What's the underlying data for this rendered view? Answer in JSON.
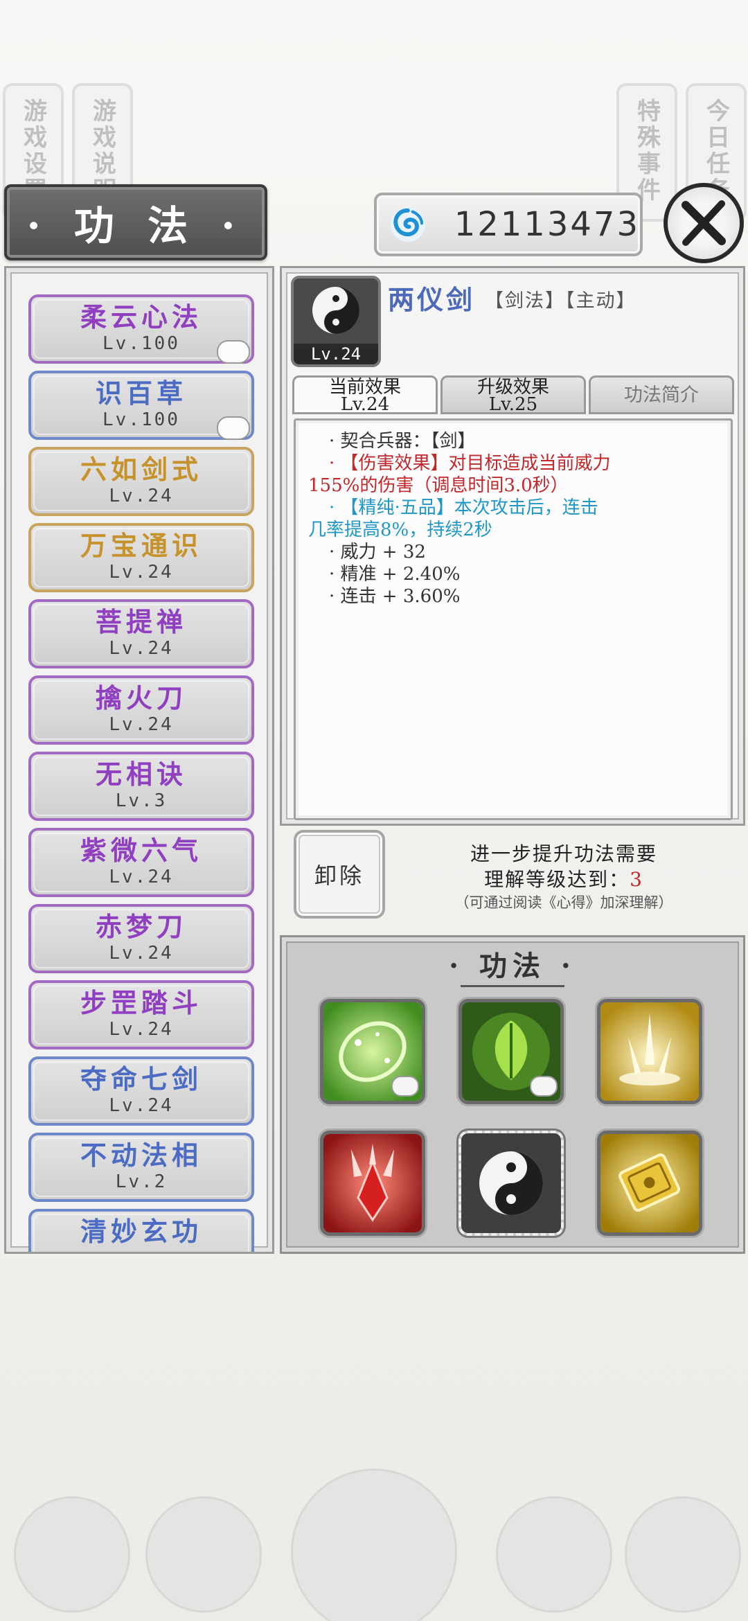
{
  "background_tabs": [
    {
      "label": "游戏设置"
    },
    {
      "label": "游戏说明"
    },
    {
      "label": "特殊事件"
    },
    {
      "label": "今日任务"
    }
  ],
  "header": {
    "title": "· 功 法 ·",
    "currency_amount": "12113473",
    "currency_icon": "spirit-swirl-icon",
    "close_icon": "close-x-icon"
  },
  "skill_list": [
    {
      "name": "柔云心法",
      "level": "Lv.100",
      "color": "purple",
      "badge": true
    },
    {
      "name": "识百草",
      "level": "Lv.100",
      "color": "blue",
      "badge": true
    },
    {
      "name": "六如剑式",
      "level": "Lv.24",
      "color": "gold",
      "badge": false
    },
    {
      "name": "万宝通识",
      "level": "Lv.24",
      "color": "gold",
      "badge": false
    },
    {
      "name": "菩提禅",
      "level": "Lv.24",
      "color": "purple",
      "badge": false
    },
    {
      "name": "擒火刀",
      "level": "Lv.24",
      "color": "purple",
      "badge": false
    },
    {
      "name": "无相诀",
      "level": "Lv.3",
      "color": "purple",
      "badge": false
    },
    {
      "name": "紫微六气",
      "level": "Lv.24",
      "color": "purple",
      "badge": false
    },
    {
      "name": "赤梦刀",
      "level": "Lv.24",
      "color": "purple",
      "badge": false
    },
    {
      "name": "步罡踏斗",
      "level": "Lv.24",
      "color": "purple",
      "badge": false
    },
    {
      "name": "夺命七剑",
      "level": "Lv.24",
      "color": "blue",
      "badge": false
    },
    {
      "name": "不动法相",
      "level": "Lv.2",
      "color": "blue",
      "badge": false
    },
    {
      "name": "清妙玄功",
      "level": "",
      "color": "blue",
      "badge": false
    }
  ],
  "detail": {
    "name": "两仪剑",
    "tags": "【剑法】【主动】",
    "level_tag": "Lv.24",
    "icon": "yin-yang-icon",
    "tabs": [
      {
        "label": "当前效果",
        "sub": "Lv.24"
      },
      {
        "label": "升级效果",
        "sub": "Lv.25"
      },
      {
        "label": "功法简介",
        "sub": ""
      }
    ],
    "effects": {
      "weapon": "· 契合兵器：【剑】",
      "damage_1": "· 【伤害效果】对目标造成当前威力",
      "damage_2": "155%的伤害（调息时间3.0秒）",
      "pure_1": "· 【精纯·五品】本次攻击后，连击",
      "pure_2": "几率提高8%，持续2秒",
      "stat_power": "· 威力 + 32",
      "stat_accuracy": "· 精准 + 2.40%",
      "stat_combo": "· 连击 + 3.60%"
    },
    "unload_label": "卸除",
    "upgrade": {
      "line1": "进一步提升功法需要",
      "line2_prefix": "理解等级达到：",
      "line2_value": "3",
      "line3": "（可通过阅读《心得》加深理解）"
    }
  },
  "equipped": {
    "title": "· 功法 ·",
    "slots": [
      {
        "icon": "green-orb-icon",
        "badge": true
      },
      {
        "icon": "green-leaf-icon",
        "badge": true
      },
      {
        "icon": "golden-swords-icon",
        "badge": false
      },
      {
        "icon": "red-crystal-icon",
        "badge": false
      },
      {
        "icon": "yin-yang-icon",
        "badge": false
      },
      {
        "icon": "golden-scroll-icon",
        "badge": false
      }
    ]
  },
  "colors": {
    "purple": "#8f3fc0",
    "blue": "#4b6cc2",
    "gold": "#c6922c",
    "damage_red": "#c0282c",
    "pure_blue": "#1e97c6"
  }
}
